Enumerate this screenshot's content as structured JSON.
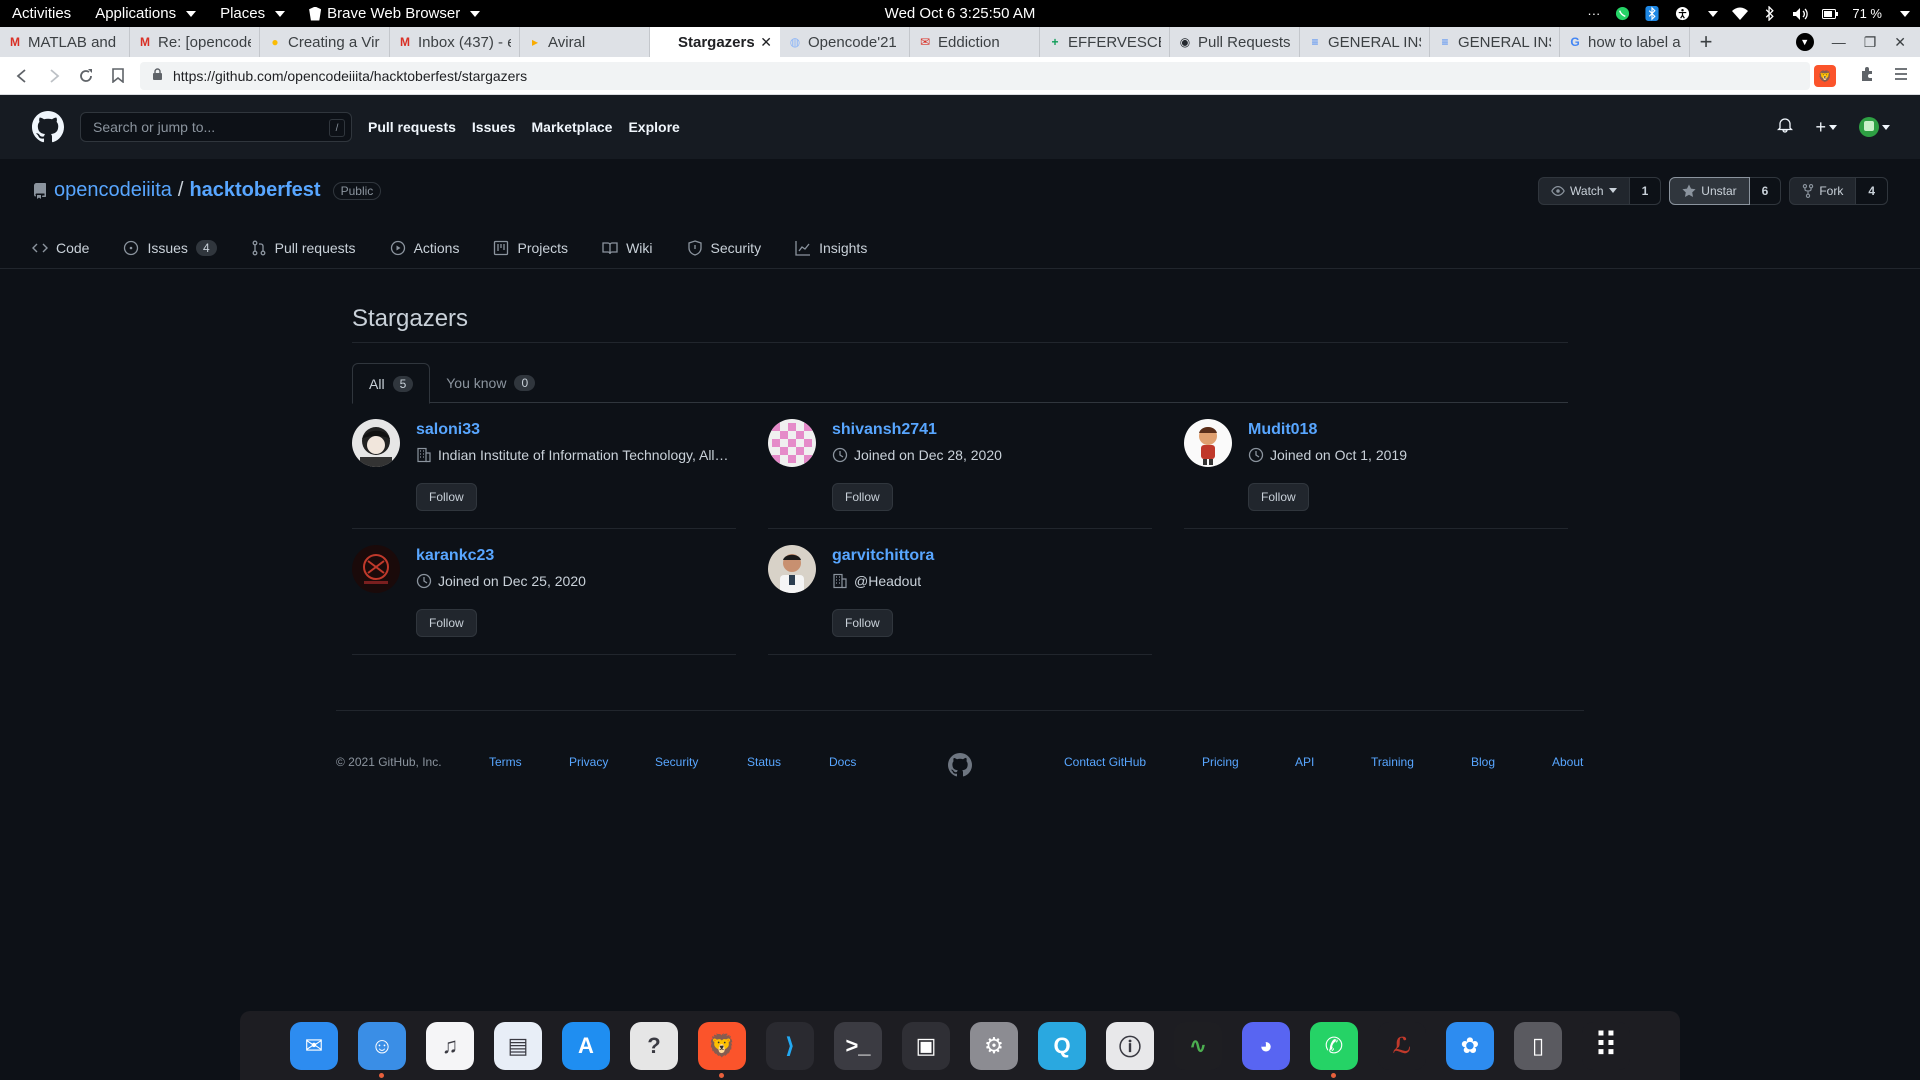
{
  "system_bar": {
    "activities": "Activities",
    "applications": "Applications",
    "places": "Places",
    "browser_menu": "Brave Web Browser",
    "clock": "Wed Oct 6   3:25:50 AM",
    "battery": "71 %",
    "more": "···"
  },
  "tabs": [
    {
      "label": "MATLAB and S",
      "icon": "gmail-icon",
      "color": "#d93025"
    },
    {
      "label": "Re: [opencode",
      "icon": "gmail-icon",
      "color": "#d93025"
    },
    {
      "label": "Creating a Vir",
      "icon": "circle-icon",
      "color": "#fbbc04"
    },
    {
      "label": "Inbox (437) - e",
      "icon": "gmail-icon",
      "color": "#d93025"
    },
    {
      "label": "Aviral",
      "icon": "play-icon",
      "color": "#f9ab00"
    },
    {
      "label": "Stargazers",
      "icon": "github-icon",
      "color": "#ffffff",
      "active": true
    },
    {
      "label": "Opencode'21",
      "icon": "globe-icon",
      "color": "#8ab4f8"
    },
    {
      "label": "Eddiction",
      "icon": "mail-badge-icon",
      "color": "#d93025"
    },
    {
      "label": "EFFERVESCEN",
      "icon": "sheets-icon",
      "color": "#0f9d58"
    },
    {
      "label": "Pull Requests",
      "icon": "github-icon",
      "color": "#24292f"
    },
    {
      "label": "GENERAL INS",
      "icon": "docs-icon",
      "color": "#4285f4"
    },
    {
      "label": "GENERAL INS",
      "icon": "docs-icon",
      "color": "#4285f4"
    },
    {
      "label": "how to label a",
      "icon": "google-icon",
      "color": "#4285f4"
    }
  ],
  "address_bar": {
    "url": "https://github.com/opencodeiiita/hacktoberfest/stargazers"
  },
  "gh_header": {
    "search_placeholder": "Search or jump to...",
    "search_key": "/",
    "nav": [
      "Pull requests",
      "Issues",
      "Marketplace",
      "Explore"
    ]
  },
  "repo": {
    "owner": "opencodeiiita",
    "separator": "/",
    "name": "hacktoberfest",
    "visibility": "Public",
    "watch_label": "Watch",
    "watch_count": "1",
    "star_label": "Unstar",
    "star_count": "6",
    "fork_label": "Fork",
    "fork_count": "4",
    "tabs": [
      {
        "label": "Code",
        "icon": "code-icon"
      },
      {
        "label": "Issues",
        "icon": "issue-icon",
        "counter": "4"
      },
      {
        "label": "Pull requests",
        "icon": "pull-request-icon"
      },
      {
        "label": "Actions",
        "icon": "play-icon"
      },
      {
        "label": "Projects",
        "icon": "project-icon"
      },
      {
        "label": "Wiki",
        "icon": "book-icon"
      },
      {
        "label": "Security",
        "icon": "shield-icon"
      },
      {
        "label": "Insights",
        "icon": "graph-icon"
      }
    ]
  },
  "stargazers": {
    "title": "Stargazers",
    "tab_all": "All",
    "tab_all_count": "5",
    "tab_know": "You know",
    "tab_know_count": "0",
    "follow_label": "Follow",
    "users": [
      {
        "name": "saloni33",
        "meta": "Indian Institute of Information Technology, Allahabad",
        "meta_icon": "organization-icon"
      },
      {
        "name": "shivansh2741",
        "meta": "Joined on Dec 28, 2020",
        "meta_icon": "clock-icon"
      },
      {
        "name": "Mudit018",
        "meta": "Joined on Oct 1, 2019",
        "meta_icon": "clock-icon"
      },
      {
        "name": "karankc23",
        "meta": "Joined on Dec 25, 2020",
        "meta_icon": "clock-icon"
      },
      {
        "name": "garvitchittora",
        "meta": "@Headout",
        "meta_icon": "organization-icon"
      }
    ]
  },
  "footer": {
    "copyright": "© 2021 GitHub, Inc.",
    "links_left": [
      "Terms",
      "Privacy",
      "Security",
      "Status",
      "Docs"
    ],
    "links_right": [
      "Contact GitHub",
      "Pricing",
      "API",
      "Training",
      "Blog",
      "About"
    ]
  },
  "dock": [
    {
      "name": "mail-app-icon",
      "color": "#2d8cf0"
    },
    {
      "name": "finder-icon",
      "color": "#3a8ee6"
    },
    {
      "name": "music-icon",
      "color": "#f5f5f7"
    },
    {
      "name": "text-editor-icon",
      "color": "#e8eef7"
    },
    {
      "name": "app-store-icon",
      "color": "#1f8ef1"
    },
    {
      "name": "help-icon",
      "color": "#e6e6e6"
    },
    {
      "name": "brave-browser-icon",
      "color": "#fb542b"
    },
    {
      "name": "vscode-icon",
      "color": "#2a2a30"
    },
    {
      "name": "terminal-icon",
      "color": "#3b3b42"
    },
    {
      "name": "screenshot-icon",
      "color": "#2f2f35"
    },
    {
      "name": "settings-icon",
      "color": "#8c8c92"
    },
    {
      "name": "quicktime-icon",
      "color": "#2aa8e0"
    },
    {
      "name": "system-info-icon",
      "color": "#e8e8ea"
    },
    {
      "name": "activity-monitor-icon",
      "color": "#1e1e22"
    },
    {
      "name": "discord-icon",
      "color": "#5865f2"
    },
    {
      "name": "whatsapp-icon",
      "color": "#25d366"
    },
    {
      "name": "app-red-icon",
      "color": "#1d1d22"
    },
    {
      "name": "gnome-tweaks-icon",
      "color": "#2d8cf0"
    },
    {
      "name": "trash-icon",
      "color": "#5a5a60"
    },
    {
      "name": "app-grid-icon",
      "color": "#1d1d22"
    }
  ]
}
